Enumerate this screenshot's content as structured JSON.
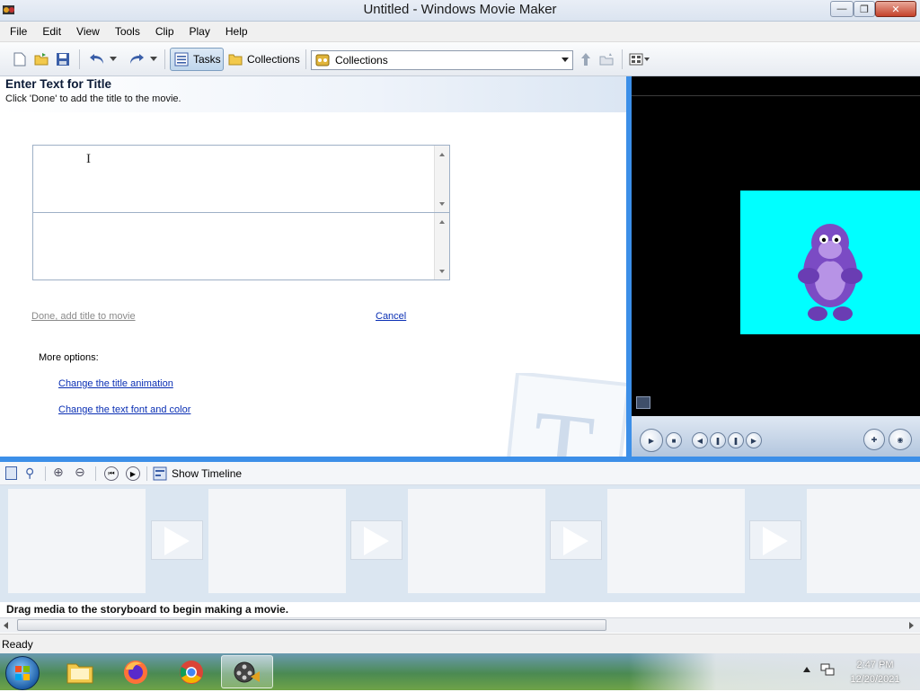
{
  "window": {
    "title": "Untitled - Windows Movie Maker",
    "minimize_icon": "minimize-icon",
    "maximize_icon": "restore-icon",
    "close_icon": "close-icon"
  },
  "menu": [
    "File",
    "Edit",
    "View",
    "Tools",
    "Clip",
    "Play",
    "Help"
  ],
  "toolbar": {
    "tasks_label": "Tasks",
    "collections_label": "Collections",
    "collections_dropdown_value": "Collections"
  },
  "task_pane": {
    "title": "Enter Text for Title",
    "subtitle": "Click 'Done' to add the title to the movie.",
    "title_text_value": "",
    "subtitle_text_value": "",
    "done_link": "Done, add title to movie",
    "cancel_link": "Cancel",
    "more_options_label": "More options:",
    "option_links": [
      "Change the title animation",
      "Change the text font and color"
    ]
  },
  "preview": {
    "background_color": "#000000",
    "image_color": "#00ffff"
  },
  "storyboard": {
    "show_timeline_label": "Show Timeline",
    "message": "Drag media to the storyboard to begin making a movie."
  },
  "status": {
    "text": "Ready"
  },
  "taskbar": {
    "time": "2:47 PM",
    "date": "12/20/2021",
    "apps": [
      "file-explorer-icon",
      "firefox-icon",
      "chrome-icon",
      "movie-maker-icon"
    ]
  },
  "colors": {
    "accent_blue": "#3c8fe8",
    "link_blue": "#0a2fb4"
  }
}
